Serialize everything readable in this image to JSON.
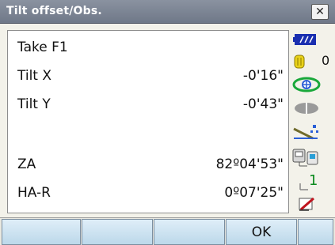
{
  "window": {
    "title": "Tilt offset/Obs.",
    "close_glyph": "✕"
  },
  "rows": [
    {
      "label": "Take F1",
      "value": ""
    },
    {
      "label": "Tilt X",
      "value": "-0'16\""
    },
    {
      "label": "Tilt Y",
      "value": "-0'43\""
    },
    {
      "label": "",
      "value": ""
    },
    {
      "label": "ZA",
      "value": "82º04'53\""
    },
    {
      "label": "HA-R",
      "value": "0º07'25\""
    }
  ],
  "status": {
    "battery_icon": "battery-icon",
    "target_icon": "target-constant-icon",
    "target_value": "0",
    "laser_icon": "laser-plummet-icon",
    "prism_icon": "prism-icon",
    "tilt_icon": "tilt-compensation-icon",
    "comm_icon": "communication-icon",
    "input_mode_value": "1",
    "pen_icon": "pen-icon"
  },
  "softkeys": [
    "",
    "",
    "",
    "OK",
    ""
  ],
  "colors": {
    "title_bar": "#7a8292",
    "softkey": "#cfe3f1",
    "battery": "#1a2fb0"
  }
}
